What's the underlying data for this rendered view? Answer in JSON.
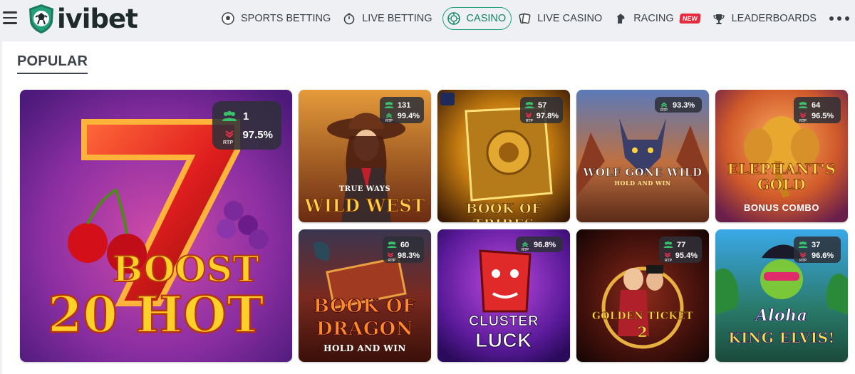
{
  "header": {
    "logo_text": "ivibet",
    "nav": [
      {
        "label": "SPORTS BETTING",
        "icon": "soccer-ball-icon"
      },
      {
        "label": "LIVE BETTING",
        "icon": "stopwatch-icon"
      },
      {
        "label": "CASINO",
        "icon": "casino-chip-icon",
        "active": true
      },
      {
        "label": "LIVE CASINO",
        "icon": "playing-cards-icon"
      },
      {
        "label": "RACING",
        "icon": "horse-head-icon",
        "badge": "NEW"
      },
      {
        "label": "LEADERBOARDS",
        "icon": "trophy-icon"
      }
    ],
    "more_icon": "more-dots-icon"
  },
  "section": {
    "title": "POPULAR"
  },
  "games": [
    {
      "name": "20 Boost Hot",
      "title_line1": "BOOST",
      "title_line2": "20 HOT",
      "players": "1",
      "rtp": "97.5%",
      "rtp_trend": "down"
    },
    {
      "name": "Wild West",
      "title_line1": "TRUE WAYS",
      "title_line2": "WILD WEST",
      "players": "131",
      "rtp": "99.4%",
      "rtp_trend": "up"
    },
    {
      "name": "Book of Tribes",
      "title_line1": "",
      "title_line2": "BOOK OF TRIBES",
      "players": "57",
      "rtp": "97.8%",
      "rtp_trend": "down"
    },
    {
      "name": "Wolf Gone Wild",
      "title_line1": "WOLF GONE WILD",
      "title_line2": "HOLD AND WIN",
      "players": "",
      "rtp": "93.3%",
      "rtp_trend": "up"
    },
    {
      "name": "Elephant's Gold",
      "title_line1": "ELEPHANT'S GOLD",
      "title_line2": "BONUS COMBO",
      "players": "64",
      "rtp": "96.5%",
      "rtp_trend": "down"
    },
    {
      "name": "Book of Dragon",
      "title_line1": "BOOK OF DRAGON",
      "title_line2": "HOLD AND WIN",
      "players": "60",
      "rtp": "98.3%",
      "rtp_trend": "down"
    },
    {
      "name": "Cluster Luck",
      "title_line1": "CLUSTER",
      "title_line2": "LUCK",
      "players": "",
      "rtp": "96.8%",
      "rtp_trend": "up"
    },
    {
      "name": "Golden Ticket 2",
      "title_line1": "GOLDEN TICKET",
      "title_line2": "2",
      "players": "77",
      "rtp": "95.4%",
      "rtp_trend": "down"
    },
    {
      "name": "Aloha King Elvis",
      "title_line1": "Aloha",
      "title_line2": "KING ELVIS!",
      "players": "37",
      "rtp": "96.6%",
      "rtp_trend": "down"
    }
  ],
  "stat_labels": {
    "rtp": "RTP"
  },
  "colors": {
    "brand_green": "#20a07f",
    "rtp_up": "#39c26a",
    "rtp_down": "#e0314a",
    "badge_new": "#e8283c"
  }
}
